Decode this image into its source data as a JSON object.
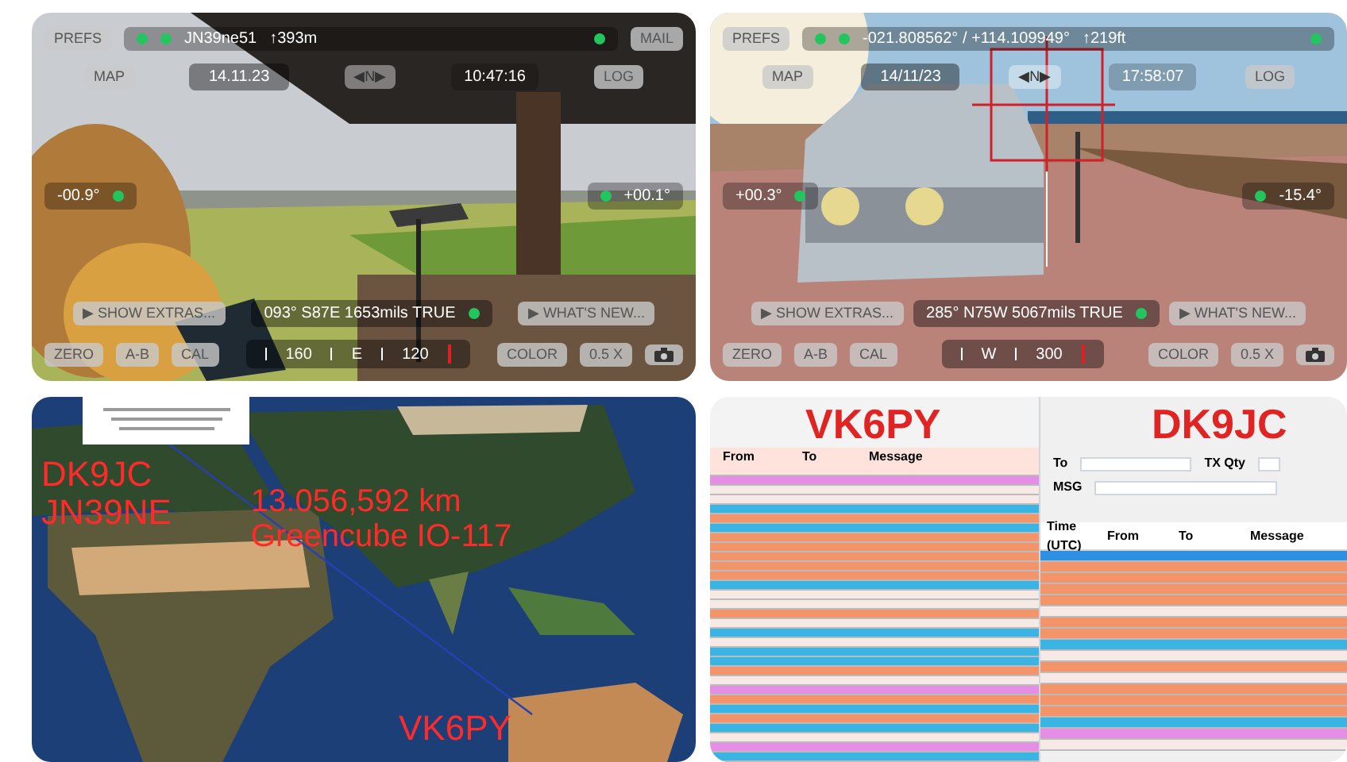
{
  "camera_views": [
    {
      "kind": "countryside",
      "prefs_button": "PREFS",
      "location": "JN39ne51",
      "altitude": "↑393m",
      "mail_button": "MAIL",
      "map_button": "MAP",
      "date": "14.11.23",
      "direction": "◀N▶",
      "time": "10:47:16",
      "log_button": "LOG",
      "left_tilt": "-00.9°",
      "right_tilt": "+00.1°",
      "extras_button": "▶ SHOW EXTRAS...",
      "heading": "093° S87E 1653mils TRUE",
      "whats_new_button": "▶ WHAT'S NEW...",
      "left_buttons": [
        "ZERO",
        "A-B",
        "CAL"
      ],
      "compass": [
        "160",
        "E",
        "120"
      ],
      "right_buttons": [
        "COLOR",
        "0.5 X"
      ]
    },
    {
      "kind": "coast",
      "prefs_button": "PREFS",
      "location": "-021.808562° / +114.109949°",
      "altitude": "↑219ft",
      "map_button": "MAP",
      "date": "14/11/23",
      "direction": "◀N▶",
      "time": "17:58:07",
      "log_button": "LOG",
      "left_tilt": "+00.3°",
      "right_tilt": "-15.4°",
      "extras_button": "▶ SHOW EXTRAS...",
      "heading": "285° N75W 5067mils TRUE",
      "whats_new_button": "▶ WHAT'S NEW...",
      "left_buttons": [
        "ZERO",
        "A-B",
        "CAL"
      ],
      "compass": [
        "W",
        "300"
      ],
      "right_buttons": [
        "COLOR",
        "0.5 X"
      ]
    }
  ],
  "map_view": {
    "kind": "picture",
    "labels": [
      "DK9JC",
      "JN39NE",
      "13.056,592 km",
      "Greencube IO-117",
      "VK6PY"
    ]
  },
  "traffic_window": {
    "left_callsign": "VK6PY",
    "right_callsign": "DK9JC",
    "left_columns": [
      "From",
      "To",
      "Message"
    ],
    "left_rows": [
      {
        "color": "#fde3dc"
      },
      {
        "color": "#e48ee6"
      },
      {
        "color": "#f6e9e6"
      },
      {
        "color": "#f6e9e6"
      },
      {
        "color": "#3bb3e3"
      },
      {
        "color": "#f4946b"
      },
      {
        "color": "#3bb3e3"
      },
      {
        "color": "#f4946b"
      },
      {
        "color": "#f4946b"
      },
      {
        "color": "#f4946b"
      },
      {
        "color": "#f4946b"
      },
      {
        "color": "#f4946b"
      },
      {
        "color": "#3bb3e3"
      },
      {
        "color": "#f6e9e6"
      },
      {
        "color": "#f6e9e6"
      },
      {
        "color": "#f4946b"
      },
      {
        "color": "#f6e9e6"
      },
      {
        "color": "#3bb3e3"
      },
      {
        "color": "#f6e9e6"
      },
      {
        "color": "#3bb3e3"
      },
      {
        "color": "#3bb3e3"
      },
      {
        "color": "#f4946b"
      },
      {
        "color": "#f6e9e6"
      },
      {
        "color": "#e48ee6"
      },
      {
        "color": "#f4946b"
      },
      {
        "color": "#3bb3e3"
      },
      {
        "color": "#f4946b"
      },
      {
        "color": "#3bb3e3"
      },
      {
        "color": "#f6e9e6"
      },
      {
        "color": "#e48ee6"
      },
      {
        "color": "#3bb3e3"
      }
    ],
    "to_label": "To",
    "tx_qty_label": "TX Qty",
    "msg_label": "MSG",
    "right_columns": [
      "Time (UTC)",
      "From",
      "To",
      "Message"
    ],
    "right_rows": [
      {
        "color": "#2f8fe0"
      },
      {
        "color": "#f4946b"
      },
      {
        "color": "#f4946b"
      },
      {
        "color": "#f4946b"
      },
      {
        "color": "#f4946b"
      },
      {
        "color": "#f6e9e6"
      },
      {
        "color": "#f4946b"
      },
      {
        "color": "#f4946b"
      },
      {
        "color": "#3bb3e3"
      },
      {
        "color": "#f6e9e6"
      },
      {
        "color": "#f4946b"
      },
      {
        "color": "#f6e9e6"
      },
      {
        "color": "#f4946b"
      },
      {
        "color": "#f4946b"
      },
      {
        "color": "#f4946b"
      },
      {
        "color": "#3bb3e3"
      },
      {
        "color": "#e48ee6"
      },
      {
        "color": "#f6e9e6"
      }
    ]
  }
}
